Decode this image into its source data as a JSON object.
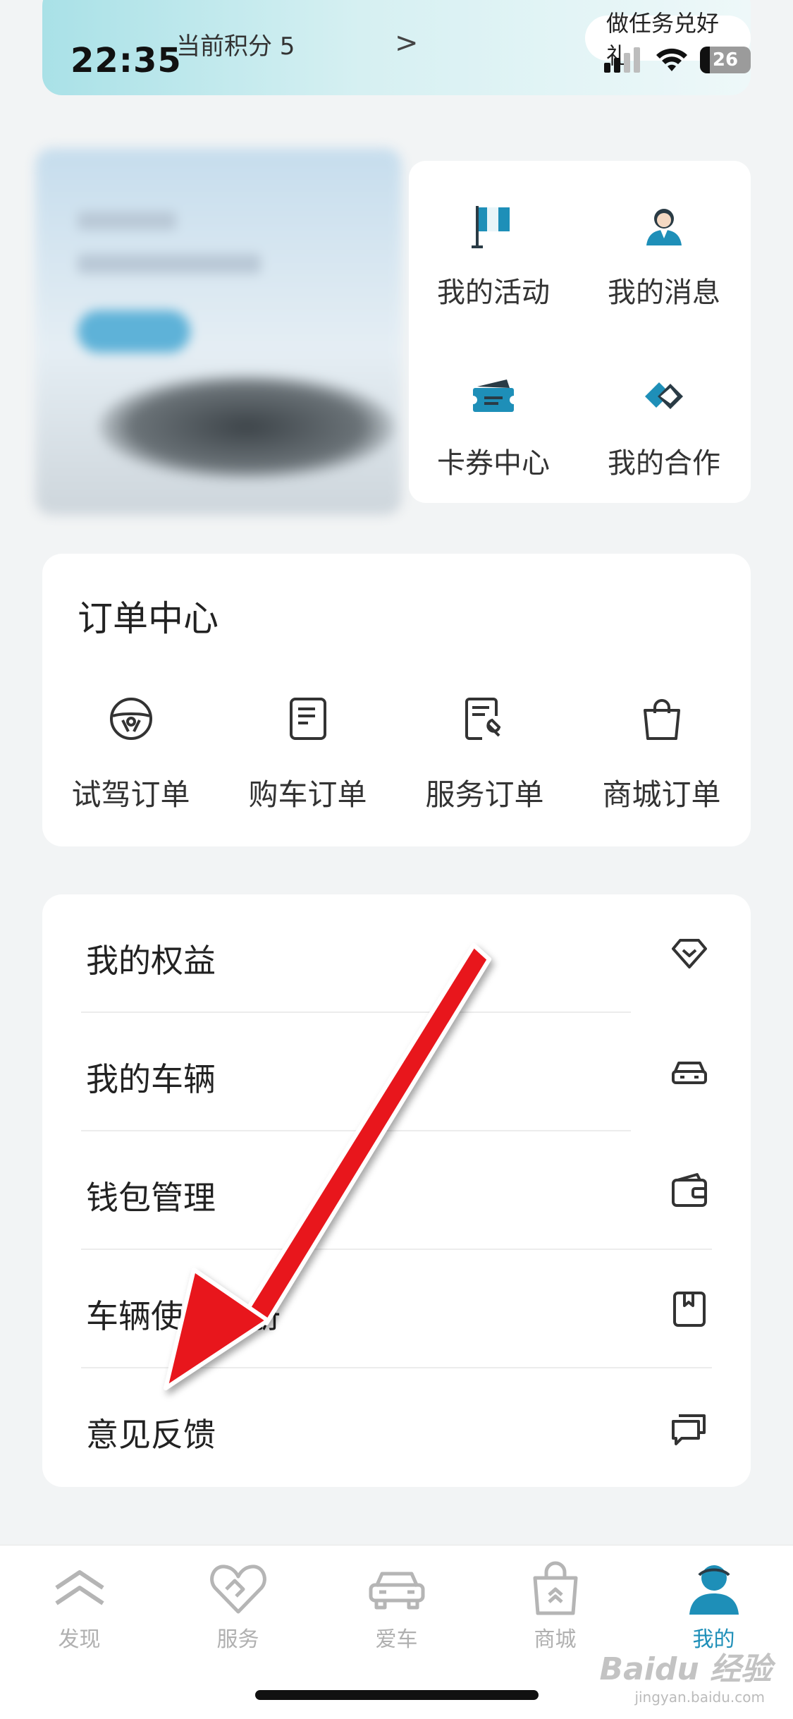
{
  "status_bar": {
    "time": "22:35",
    "battery": "26"
  },
  "points_banner": {
    "points_label": "当前积分 5",
    "chevron": ">",
    "task_button": "做任务兑好礼"
  },
  "quick_actions": [
    {
      "label": "我的活动",
      "icon": "flag-icon"
    },
    {
      "label": "我的消息",
      "icon": "person-message-icon"
    },
    {
      "label": "卡券中心",
      "icon": "ticket-icon"
    },
    {
      "label": "我的合作",
      "icon": "handshake-icon"
    }
  ],
  "order_center": {
    "title": "订单中心",
    "items": [
      {
        "label": "试驾订单",
        "icon": "steering-wheel-icon"
      },
      {
        "label": "购车订单",
        "icon": "document-icon"
      },
      {
        "label": "服务订单",
        "icon": "service-wrench-icon"
      },
      {
        "label": "商城订单",
        "icon": "shopping-bag-icon"
      }
    ]
  },
  "menu": [
    {
      "label": "我的权益",
      "icon": "diamond-heart-icon"
    },
    {
      "label": "我的车辆",
      "icon": "car-icon"
    },
    {
      "label": "钱包管理",
      "icon": "wallet-icon"
    },
    {
      "label": "车辆使用手册",
      "icon": "manual-book-icon"
    },
    {
      "label": "意见反馈",
      "icon": "feedback-chat-icon"
    }
  ],
  "tab_bar": [
    {
      "label": "发现",
      "icon": "citroen-logo-icon",
      "active": false
    },
    {
      "label": "服务",
      "icon": "heart-handshake-icon",
      "active": false
    },
    {
      "label": "爱车",
      "icon": "car-front-icon",
      "active": false
    },
    {
      "label": "商城",
      "icon": "bag-icon",
      "active": false
    },
    {
      "label": "我的",
      "icon": "user-icon",
      "active": true
    }
  ],
  "colors": {
    "accent": "#1e8fb8",
    "arrow": "#e8141c",
    "background": "#f2f4f5"
  },
  "watermark": {
    "main": "Baidu 经验",
    "sub": "jingyan.baidu.com"
  }
}
